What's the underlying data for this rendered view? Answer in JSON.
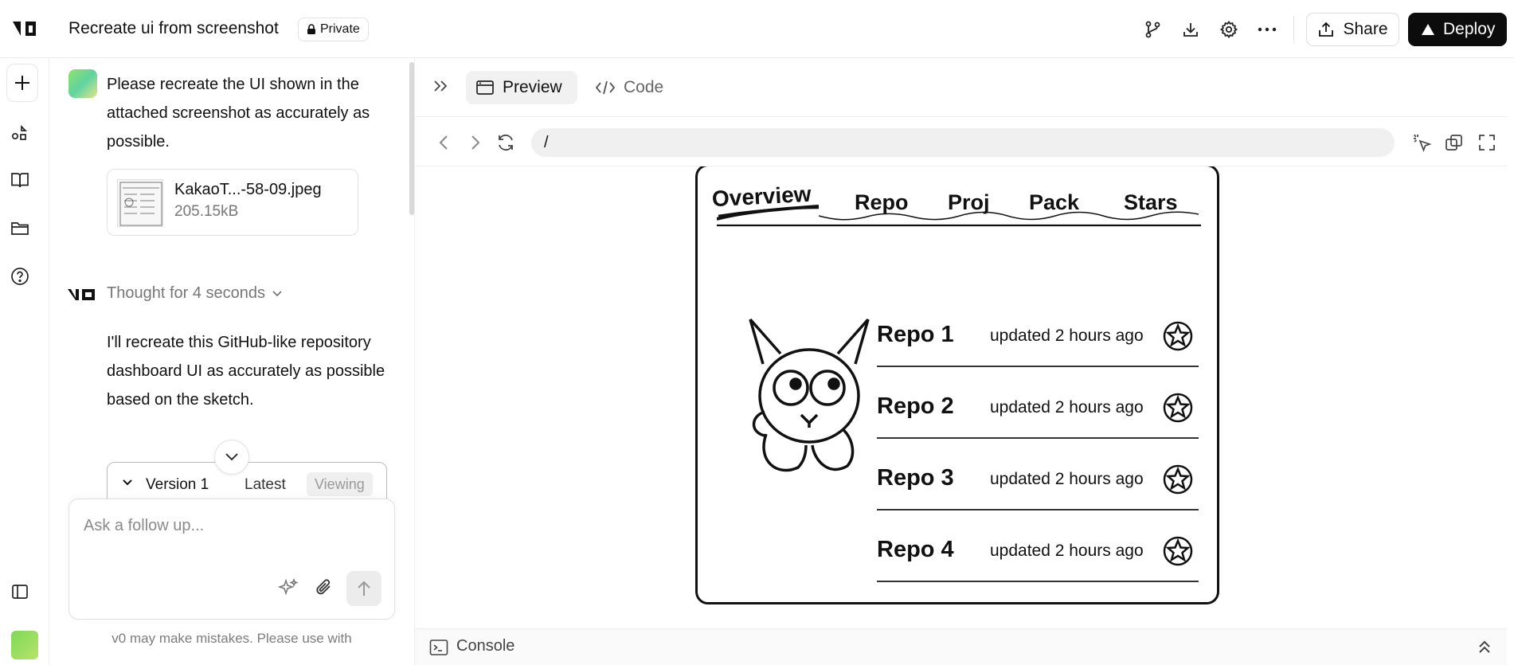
{
  "header": {
    "title": "Recreate ui from screenshot",
    "privacy": "Private",
    "share_label": "Share",
    "deploy_label": "Deploy"
  },
  "chat": {
    "user_message": "Please recreate the UI shown in the attached screenshot as accurately as possible.",
    "attachment": {
      "name": "KakaoT...-58-09.jpeg",
      "size": "205.15kB"
    },
    "thought": "Thought for 4 seconds",
    "assistant_message": "I'll recreate this GitHub-like repository dashboard UI as accurately as possible based on the sketch.",
    "version": {
      "label": "Version 1",
      "latest": "Latest",
      "viewing": "Viewing"
    },
    "input_placeholder": "Ask a follow up...",
    "disclaimer": "v0 may make mistakes. Please use with"
  },
  "preview": {
    "tabs": {
      "preview": "Preview",
      "code": "Code"
    },
    "url": "/",
    "console_label": "Console",
    "sketch": {
      "nav": [
        "Overview",
        "Repo",
        "Proj",
        "Pack",
        "Stars"
      ],
      "repos": [
        {
          "name": "Repo 1",
          "updated": "updated 2 hours ago"
        },
        {
          "name": "Repo 2",
          "updated": "updated 2 hours ago"
        },
        {
          "name": "Repo 3",
          "updated": "updated 2 hours ago"
        },
        {
          "name": "Repo 4",
          "updated": "updated 2 hours ago"
        }
      ]
    }
  },
  "colors": {
    "deploy_bg": "#0c0c0c",
    "accent_gradient_start": "#92e36b",
    "accent_gradient_end": "#5fd3a0"
  }
}
